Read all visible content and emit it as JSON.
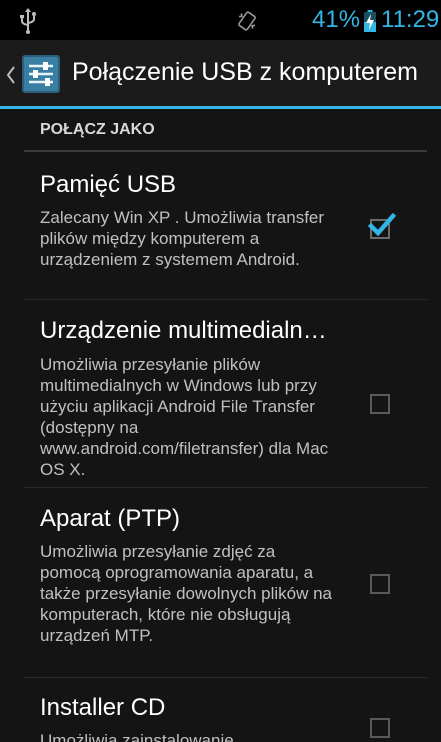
{
  "status_bar": {
    "battery_percent": "41%",
    "time": "11:29",
    "accent_color": "#33b5e5",
    "icons": [
      "usb-icon",
      "vibrate-icon",
      "battery-charging-icon"
    ]
  },
  "action_bar": {
    "title": "Połączenie USB z komputerem",
    "up_icon": "chevron-left-icon",
    "app_icon": "settings-sliders-icon"
  },
  "section": {
    "header": "POŁĄCZ JAKO"
  },
  "options": [
    {
      "title": "Pamięć USB",
      "summary": "Zalecany Win XP . Umożliwia transfer plików między komputerem a urządzeniem z systemem Android.",
      "checked": true
    },
    {
      "title": "Urządzenie multimedialn…",
      "summary": "Umożliwia przesyłanie plików multimedialnych w Windows lub przy użyciu aplikacji Android File Transfer (dostępny na www.android.com/filetransfer) dla Mac OS X.",
      "checked": false
    },
    {
      "title": "Aparat (PTP)",
      "summary": "Umożliwia przesyłanie zdjęć za pomocą oprogramowania aparatu, a także przesyłanie dowolnych plików na komputerach, które nie obsługują urządzeń MTP.",
      "checked": false
    },
    {
      "title": "Installer CD",
      "summary": "Umożliwia zainstalowanie",
      "checked": false
    }
  ]
}
